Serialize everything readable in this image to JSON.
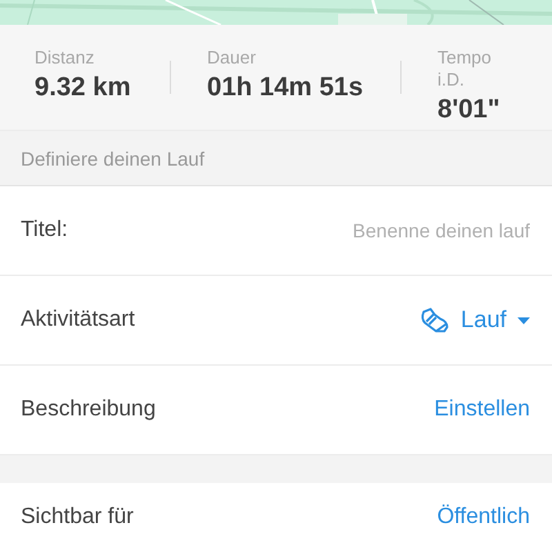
{
  "stats": [
    {
      "label": "Distanz",
      "value": "9.32 km"
    },
    {
      "label": "Dauer",
      "value": "01h 14m 51s"
    },
    {
      "label": "Tempo i.D.",
      "value": "8'01\""
    }
  ],
  "section_title": "Definiere deinen Lauf",
  "rows": [
    {
      "kind": "field",
      "label": "Titel:",
      "placeholder": "Benenne deinen lauf"
    },
    {
      "kind": "select",
      "label": "Aktivitätsart",
      "value": "Lauf"
    },
    {
      "kind": "link",
      "label": "Beschreibung",
      "value": "Einstellen"
    },
    {
      "kind": "gap"
    },
    {
      "kind": "link",
      "label": "Sichtbar für",
      "value": "Öffentlich"
    }
  ]
}
